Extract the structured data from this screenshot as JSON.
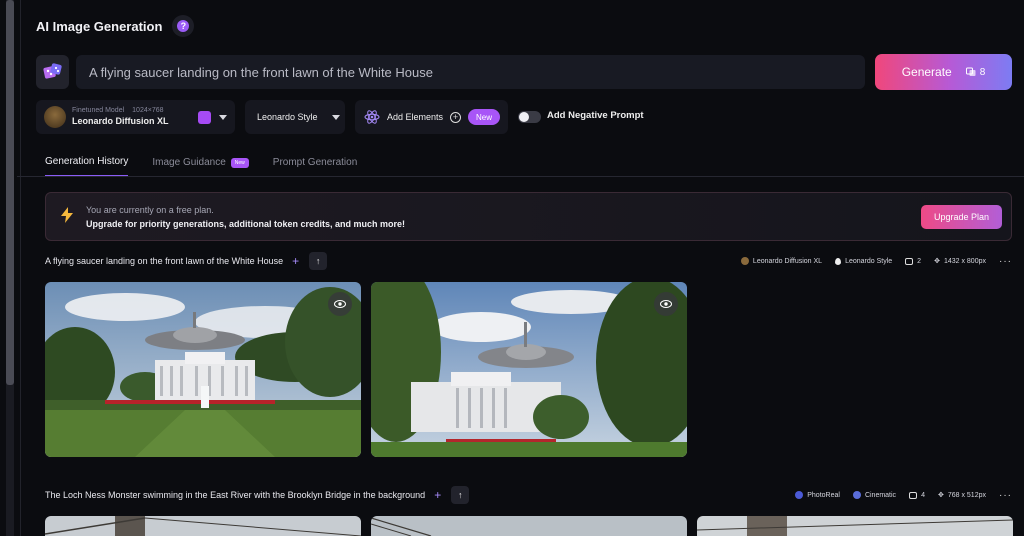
{
  "header": {
    "title": "AI Image Generation",
    "help_icon": "?"
  },
  "prompt": {
    "value": "A flying saucer landing on the front lawn of the White House"
  },
  "generate": {
    "label": "Generate",
    "tokens": "8"
  },
  "model": {
    "caption": "Finetuned Model",
    "dims": "1024×768",
    "name": "Leonardo Diffusion XL"
  },
  "style": {
    "label": "Leonardo Style"
  },
  "elements": {
    "label": "Add Elements",
    "new_badge": "New"
  },
  "negative_prompt": {
    "label": "Add Negative Prompt",
    "enabled": false
  },
  "tabs": [
    {
      "label": "Generation History",
      "active": true
    },
    {
      "label": "Image Guidance",
      "badge": "New"
    },
    {
      "label": "Prompt Generation"
    }
  ],
  "banner": {
    "line1": "You are currently on a free plan.",
    "line2": "Upgrade for priority generations, additional token credits, and much more!",
    "button": "Upgrade Plan"
  },
  "generations": [
    {
      "prompt": "A flying saucer landing on the front lawn of the White House",
      "model": "Leonardo Diffusion XL",
      "style": "Leonardo Style",
      "count": "2",
      "size": "1432 x 800px"
    },
    {
      "prompt": "The Loch Ness Monster swimming in the East River with the Brooklyn Bridge in the background",
      "model": "PhotoReal",
      "style": "Cinematic",
      "count": "4",
      "size": "768 x 512px"
    }
  ],
  "colors": {
    "accent": "#8b5cf6",
    "generate_start": "#f0477b",
    "generate_end": "#7d7cf3",
    "background": "#0b0c10"
  }
}
